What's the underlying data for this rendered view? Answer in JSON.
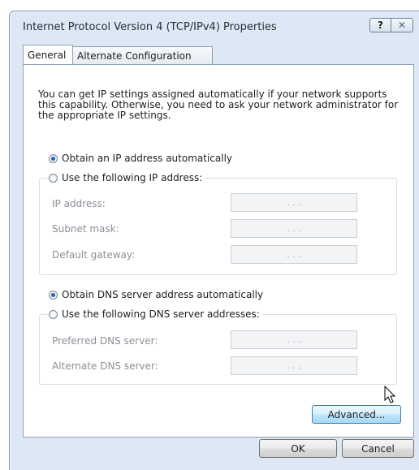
{
  "window": {
    "title": "Internet Protocol Version 4 (TCP/IPv4) Properties",
    "help_glyph": "?",
    "close_glyph": "✕"
  },
  "tabs": [
    {
      "label": "General",
      "selected": true
    },
    {
      "label": "Alternate Configuration",
      "selected": false
    }
  ],
  "description": "You can get IP settings assigned automatically if your network supports this capability. Otherwise, you need to ask your network administrator for the appropriate IP settings.",
  "ip_section": {
    "auto_label": "Obtain an IP address automatically",
    "auto_selected": true,
    "manual_label": "Use the following IP address:",
    "fields": [
      {
        "label": "IP address:",
        "value": ". . ."
      },
      {
        "label": "Subnet mask:",
        "value": ". . ."
      },
      {
        "label": "Default gateway:",
        "value": ". . ."
      }
    ]
  },
  "dns_section": {
    "auto_label": "Obtain DNS server address automatically",
    "auto_selected": true,
    "manual_label": "Use the following DNS server addresses:",
    "fields": [
      {
        "label": "Preferred DNS server:",
        "value": ". . ."
      },
      {
        "label": "Alternate DNS server:",
        "value": ". . ."
      }
    ]
  },
  "buttons": {
    "advanced": "Advanced...",
    "ok": "OK",
    "cancel": "Cancel"
  },
  "colors": {
    "window_frame": "#dde8f4",
    "accent": "#2a5fb7"
  }
}
